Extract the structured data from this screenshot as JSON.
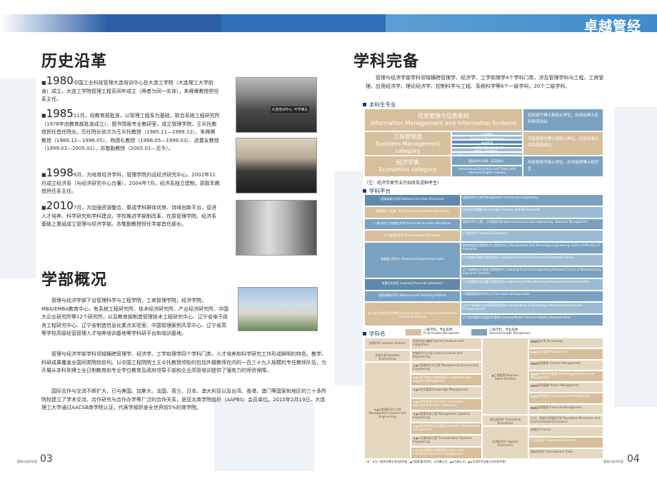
{
  "brand": "卓越管经",
  "left": {
    "history_title": "历史沿革",
    "history": [
      {
        "year": "1980",
        "text": "中国工业科技管理大连培训中心在大连工学院（大连理工大学前身）成立，大连工学院管理工程系同年成立（两者为同一实体），朱舜卿教授担任系主任。"
      },
      {
        "year": "1985",
        "text": "11月，经教育部批准，以管理工程系为基础，联合系统工程研究所（1978年由教育部批准成立）、图书情报专业教研室，成立管理学院，王众托教授担任首任院长。历任院长依次为王众托教授（1985.11—1989.12）、朱舜卿教授（1989.12—1996.05）、杨德礼教授（1996.05—1999.03）、武春友教授（1999.03—2005.01）、苏敬勤教授（2005.01—至今）。"
      },
      {
        "year": "1998",
        "text": "6月，为培育经济学科，管理学院内设经济研究中心。2002年11月成立经济系（与经济研究中心合署）。2004年7月，经济系独立建制，原毅军教授担任系主任。"
      },
      {
        "year": "2010",
        "text": "7月，为加强资源整合、集成学科群体优势、持续创新平台，促进人才培养、科学研究和学科建设，学校推进学部制改革，在原管理学院、经济系基础上重组成立管理与经济学部。苏敬勤教授担任学部首任部长。"
      }
    ],
    "faculty_title": "学部概况",
    "faculty_paras": [
      "管理与经济学部下设管理科学与工程学院，工商管理学院，经济学院，MBA/EMBA教育中心，有系统工程研究所、技术经济研究所、产业经济研究所、中国大企业研究所等12个研究所，以及教育部制造管理技术工程研究中心、辽宁省电子政务工程研究中心、辽宁省制造信息化重点实验室、中国管理案例共享中心、辽宁省高等学校高级经营管理人才培养培训基地等学科研平台和培训基地。",
      "管理与经济学部学科领域横跨管理学、经济学、工学和理学四个学科门类，人才培养和科学研究工作形成鲜明的特色，教学、科研成果覆盖全国同类院校前列。以中国工程院院士王众托教授领衔的包括外籍教师在内的一百三十九人规模的专任教师队伍，为开展从本科到博士全日制教育和专业学位教育及政府领导干部和企业高管培训提供了强有力的师资保障。",
      "国际合作与交流不断扩大，已与美国、加拿大、法国、荷兰、日本、澳大利亚以及台湾、香港、澳门等国家和地区的三十多所院校建立了学术交流、合作研究与合作办学等广泛的合作关系，是亚太商学院组织（AAPBS）会员单位。2015年2月19日，大连理工大学通过AACSB商学院认证，代表学部跻身全世界前5%的商学院。"
    ],
    "photo_captions": [
      "大连培训中心 开学典礼"
    ],
    "page_number": "03",
    "page_tag": "管理与经济学部"
  },
  "right": {
    "title": "学科完备",
    "intro": "管理与经济学部学科领域横跨管理学、经济学、工学和理学4个学科门类，涉及管理学科与工程、工商管理、应用经济学、理论经济学、控制科学与工程、系统科学等6个一级学科，20个二级学科。",
    "undergrad_head": "本科生专业",
    "undergrad": [
      {
        "cat": "信息管理与信息系统",
        "cat_en": "Information Management and Information Systems",
        "majors": [],
        "note": "有权授予博士和硕士学位，并设有博士后科研流动站"
      },
      {
        "cat": "工商管理类",
        "cat_en": "Business Management category",
        "majors": [
          "工商管理",
          "Business Management",
          "物流管理",
          "Logistics Management",
          "金融学（英语强化）",
          "Finance(with intensive English courses)"
        ],
        "note": "均有权授予博士和硕士学位，并设有博士后科研流动站"
      },
      {
        "cat": "经济学类",
        "cat_en": "Economics category",
        "majors": [
          "国际经济与贸易（英语强化）",
          "International Economics and Trade (with intensive English courses)"
        ],
        "note": "均有权授予硕士学位，并可培养博士研究生"
      }
    ],
    "undergrad_note": "（注：经济学类专业只招收英语种考生）",
    "platform_head": "学科平台",
    "platforms": [
      {
        "left": "国家级重点学科 National Level Key Disciplines",
        "right": "管理科学与工程 Management science and engineering"
      },
      {
        "left": "国家重点（培育）学科 Provincial Level Key Disciplines",
        "right": "技术经济及管理 Technology Economy and Management"
      },
      {
        "left": "一级学科辽宁省重点学科 Provincial Level Key Disciplines",
        "right": "管理科学与工程、工商管理 Management science and engineering , Business Management"
      },
      {
        "left": "辽宁省重点学科 Provincial Key Disciplines",
        "right": "产业经济学 Industrial Economics"
      },
      {
        "left": "省部级工程中心 Provincial Engineering Center",
        "right": "教育部制造业管理技术工程研究中心 Management and Technology Engineering Center of Ministry of Education"
      },
      {
        "left": "",
        "right": "辽宁省电子政务工程研究中心 Liaoning Provincial E-Government Research Center"
      },
      {
        "left": "",
        "right": "辽宁省制造执行系统工程研究中心 Liaoning Provincial Engineering Research Center of Manufacturing Execution Systems"
      },
      {
        "left": "省重点实验室 Liaoning Provincial Laboratory",
        "right": "辽宁省制造信息化重点实验室 Key Laboratory of Manufacturing Management Informatization"
      },
      {
        "left": "国家级教学平台 National Level Teaching Platform",
        "right": "中国管理案例共享中心 China case-sharing center"
      },
      {
        "left": "省人文社会科学研究基地 Research Base of Provincial Humanities and Social Science",
        "right": "辽宁产业创新与企业管理研究基地 Liaoning Base of Technology Industry Innovation and Entrepreneurial"
      },
      {
        "left": "",
        "right": "辽宁现代服务业发展研究基地 Liaoning Modern Service Industry Research Base"
      }
    ],
    "disc_head": "学科名",
    "legend": [
      {
        "label": "一级学科、专业名称",
        "label_en": "First-Grade Disciplines",
        "color": "#d7bf9c"
      },
      {
        "label": "二级学科、专业名称",
        "label_en": "Second-Grade Disciplines",
        "color": "#7aa1c0"
      }
    ],
    "disciplines_left": [
      {
        "name": "系统科学 Systems Science",
        "subs": [
          "系统分析与集成 System Analysis and Integration"
        ]
      },
      {
        "name": "系统工程 Systems Engineering",
        "subs": [
          "控制科学与工程 Control Science and Engineering"
        ]
      },
      {
        "name": "★▲★管理科学与工程 Management Science and Engineering",
        "subs": [
          "★▲★管理科学与工程 Management Science and Engineering",
          "★▲★电子商务与物流管理 E-commerce and Logistics Management",
          "★▲★知识管理 Knowledge Management",
          "★▲★信息管理与电子商务 Information Management and E-commerce",
          "★▲★管理系统工程 Management Systems Engineering",
          "★▲★经济系统分析与管理 Economic Analysis and Management",
          "★▲★交通系统工程 Transportation Systems Engineering",
          "★★★图书情报与档案管理 Library and Information Resource Management"
        ]
      }
    ],
    "disciplines_right": [
      {
        "name": "▲工商管理 Business Administration",
        "subs": [
          "▲▲▲会计学 Accounting",
          "▲▲▲企业管理 Management",
          "▲▲▲旅游管理 Tourism Management",
          "▲▲▲技术经济及管理 Technology Economy and Management",
          "▲▲▲项目管理 Project Management",
          "▲▲▲环境管理 Environmental Management",
          "▲▲▲金融管理 Financial Management"
        ]
      },
      {
        "name": "理论经济学 Theoretical Economics",
        "subs": [
          "人口、资源与环境经济学 Population Resources and Environmental Economics"
        ]
      },
      {
        "name": "应用经济学 Applied Economics",
        "subs": [
          "金融学 Finance",
          "产业经济学 Industrial Economics",
          "国际贸易学 International Trade"
        ]
      }
    ],
    "footnote": "（注：★为一级学科博士学位授予权；▲为国家重点学科；★为博士点；▲★为硕士点；▲★为学科专业硕士学位授予权）",
    "page_number": "04",
    "page_tag": "管理与经济学部"
  }
}
